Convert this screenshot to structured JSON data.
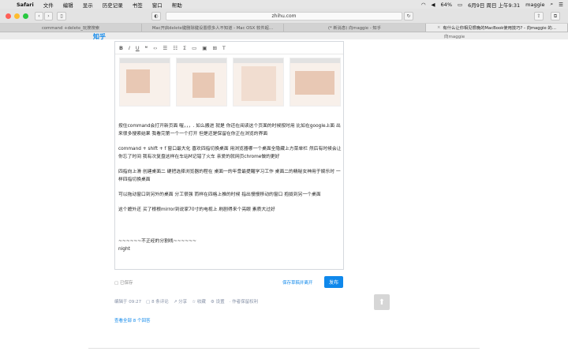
{
  "menubar": {
    "app": "Safari",
    "items": [
      "文件",
      "编辑",
      "显示",
      "历史记录",
      "书签",
      "窗口",
      "帮助"
    ],
    "battery": "64%",
    "datetime": "6月9日 周日 上午9:31",
    "user": "maggie"
  },
  "toolbar": {
    "url": "zhihu.com"
  },
  "tabs": [
    "command +delete_玩搜搜索",
    "Mac开启delete键删除键设置很多人不知道 - Mac OSX 软件超…",
    "(* 新消息) 向maggie - 知乎",
    "有什么让你相见恨晚的MacBook使用技巧? - 向maggie 的…"
  ],
  "site": {
    "logo": "知乎",
    "user": "向maggie"
  },
  "editor": {
    "toolbar_icons": [
      "B",
      "I",
      "U",
      "❝",
      "‹›",
      "☰",
      "☷",
      "Σ",
      "▭",
      "▣",
      "⊞",
      "T"
    ],
    "paragraphs": [
      "按住command会打开新页面 喔，，，. 如么搬进 就是 你还在阅读这个页面的时候按时用 比如在google上面 出来很多搜索结果 我看完第一个一个打开 但是还是保留在你正在浏览的界面",
      "command + shift + f 窗口最大化 喜欢四指切换桌面 用浏览器哪一个桌面全隐藏上方菜单栏 然后有时候会让你忘了时间 我有次复盘这样在车站M记错了火车 亲爱的就网页chrome做的更好",
      "四指向上滑 创建桌面二 硬把选择浏览器的程在 桌面一的年誊最提醒学习工作 桌面二的精秘女神用于娱乐时 一样四指切换桌面",
      "可以拖动窗口到另外的桌面 分工很强 而样在四格上推的时候 指出慢慢移动的窗口 抱拢到另一个桌面",
      "这个嬷外还 买了根根mirror到说家70寸的电视上 刷剧得来个亮眼 素质大过好"
    ],
    "divider_line": "~~~~~~不正经的分割线~~~~~~",
    "signature": "night"
  },
  "footer": {
    "draft": "已保存",
    "save_link": "保存草稿并离开",
    "publish": "发布"
  },
  "meta": {
    "edited": "编辑于 09:27",
    "comments": "8 条评论",
    "share": "分享",
    "collect": "收藏",
    "settings": "设置",
    "copyright": "作者保留权利"
  },
  "all_answers": "查看全部 8 个回答",
  "colors": {
    "accent": "#0f88eb",
    "chrome": "#e3e3e3"
  }
}
